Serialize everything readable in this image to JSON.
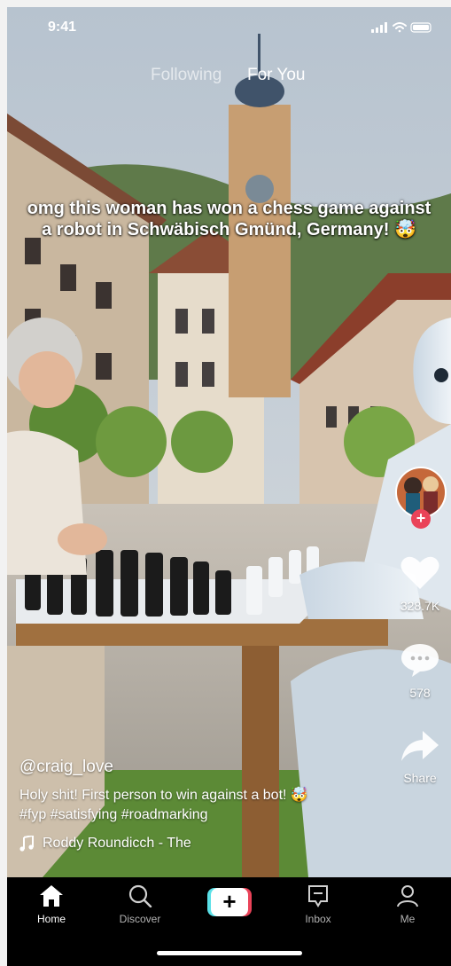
{
  "status_bar": {
    "time": "9:41"
  },
  "feed_tabs": {
    "following": "Following",
    "for_you": "For You"
  },
  "video": {
    "overlay_caption": "omg this woman has won a chess game against a robot in Schwäbisch Gmünd, Germany! 🤯"
  },
  "actions": {
    "likes": "328.7K",
    "comments": "578",
    "share": "Share",
    "follow_symbol": "+"
  },
  "post": {
    "username": "@craig_love",
    "description_line1": "Holy shit! First person to win against a bot! 🤯",
    "description_line2": "#fyp #satisfying #roadmarking",
    "music": "Roddy Roundicch - The"
  },
  "tab_bar": {
    "home": "Home",
    "discover": "Discover",
    "create_symbol": "+",
    "inbox": "Inbox",
    "me": "Me"
  },
  "colors": {
    "accent_red": "#ea4359",
    "accent_cyan": "#5ae0e7",
    "background": "#000000"
  },
  "icons": [
    "home-icon",
    "search-icon",
    "plus-icon",
    "inbox-icon",
    "person-icon",
    "heart-icon",
    "comment-icon",
    "share-icon",
    "music-note-icon"
  ]
}
